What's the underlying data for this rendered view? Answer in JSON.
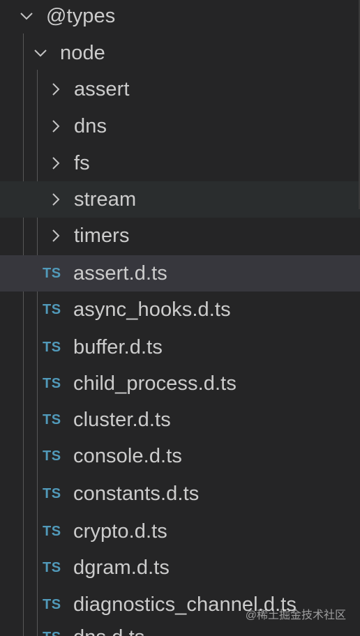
{
  "tree": {
    "root": {
      "label": "@types",
      "expanded": true,
      "icon": "chevron-down-icon"
    },
    "child": {
      "label": "node",
      "expanded": true,
      "icon": "chevron-down-icon"
    },
    "folders": [
      {
        "label": "assert",
        "icon": "chevron-right-icon"
      },
      {
        "label": "dns",
        "icon": "chevron-right-icon"
      },
      {
        "label": "fs",
        "icon": "chevron-right-icon"
      },
      {
        "label": "stream",
        "icon": "chevron-right-icon",
        "state": "hover"
      },
      {
        "label": "timers",
        "icon": "chevron-right-icon"
      }
    ],
    "files": [
      {
        "icon_text": "TS",
        "label": "assert.d.ts",
        "state": "selected"
      },
      {
        "icon_text": "TS",
        "label": "async_hooks.d.ts"
      },
      {
        "icon_text": "TS",
        "label": "buffer.d.ts"
      },
      {
        "icon_text": "TS",
        "label": "child_process.d.ts"
      },
      {
        "icon_text": "TS",
        "label": "cluster.d.ts"
      },
      {
        "icon_text": "TS",
        "label": "console.d.ts"
      },
      {
        "icon_text": "TS",
        "label": "constants.d.ts"
      },
      {
        "icon_text": "TS",
        "label": "crypto.d.ts"
      },
      {
        "icon_text": "TS",
        "label": "dgram.d.ts"
      },
      {
        "icon_text": "TS",
        "label": "diagnostics_channel.d.ts"
      },
      {
        "icon_text": "TS",
        "label": "dns.d.ts"
      }
    ]
  },
  "colors": {
    "background": "#252526",
    "hover": "#2a2d2e",
    "selected": "#37373d",
    "text": "#cccccc",
    "ts_icon": "#519aba"
  },
  "watermark": "@稀土掘金技术社区"
}
